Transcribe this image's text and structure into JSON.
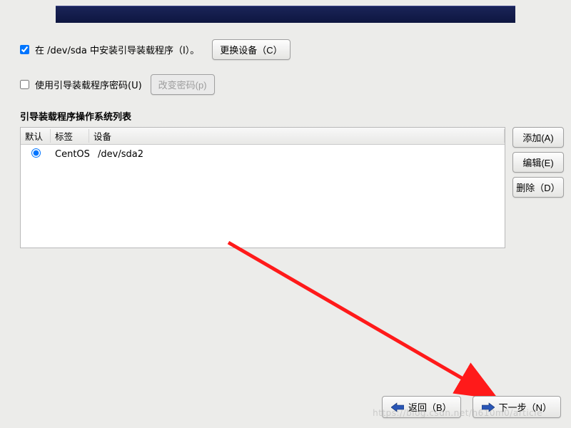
{
  "install_bootloader": {
    "checked": true,
    "label": "在 /dev/sda 中安装引导装载程序（I）。",
    "change_device_btn": "更换设备（C）"
  },
  "use_password": {
    "checked": false,
    "label": "使用引导装载程序密码(U)",
    "change_password_btn": "改变密码(p)"
  },
  "section_title": "引导装载程序操作系统列表",
  "table": {
    "headers": {
      "default": "默认",
      "label": "标签",
      "device": "设备"
    },
    "rows": [
      {
        "selected": true,
        "label": "CentOS",
        "device": "/dev/sda2"
      }
    ]
  },
  "side_buttons": {
    "add": "添加(A)",
    "edit": "编辑(E)",
    "delete": "删除（D）"
  },
  "footer": {
    "back": "返回（B）",
    "next": "下一步（N）"
  },
  "watermark": "https://blog.csdn.net/h610m0/article"
}
